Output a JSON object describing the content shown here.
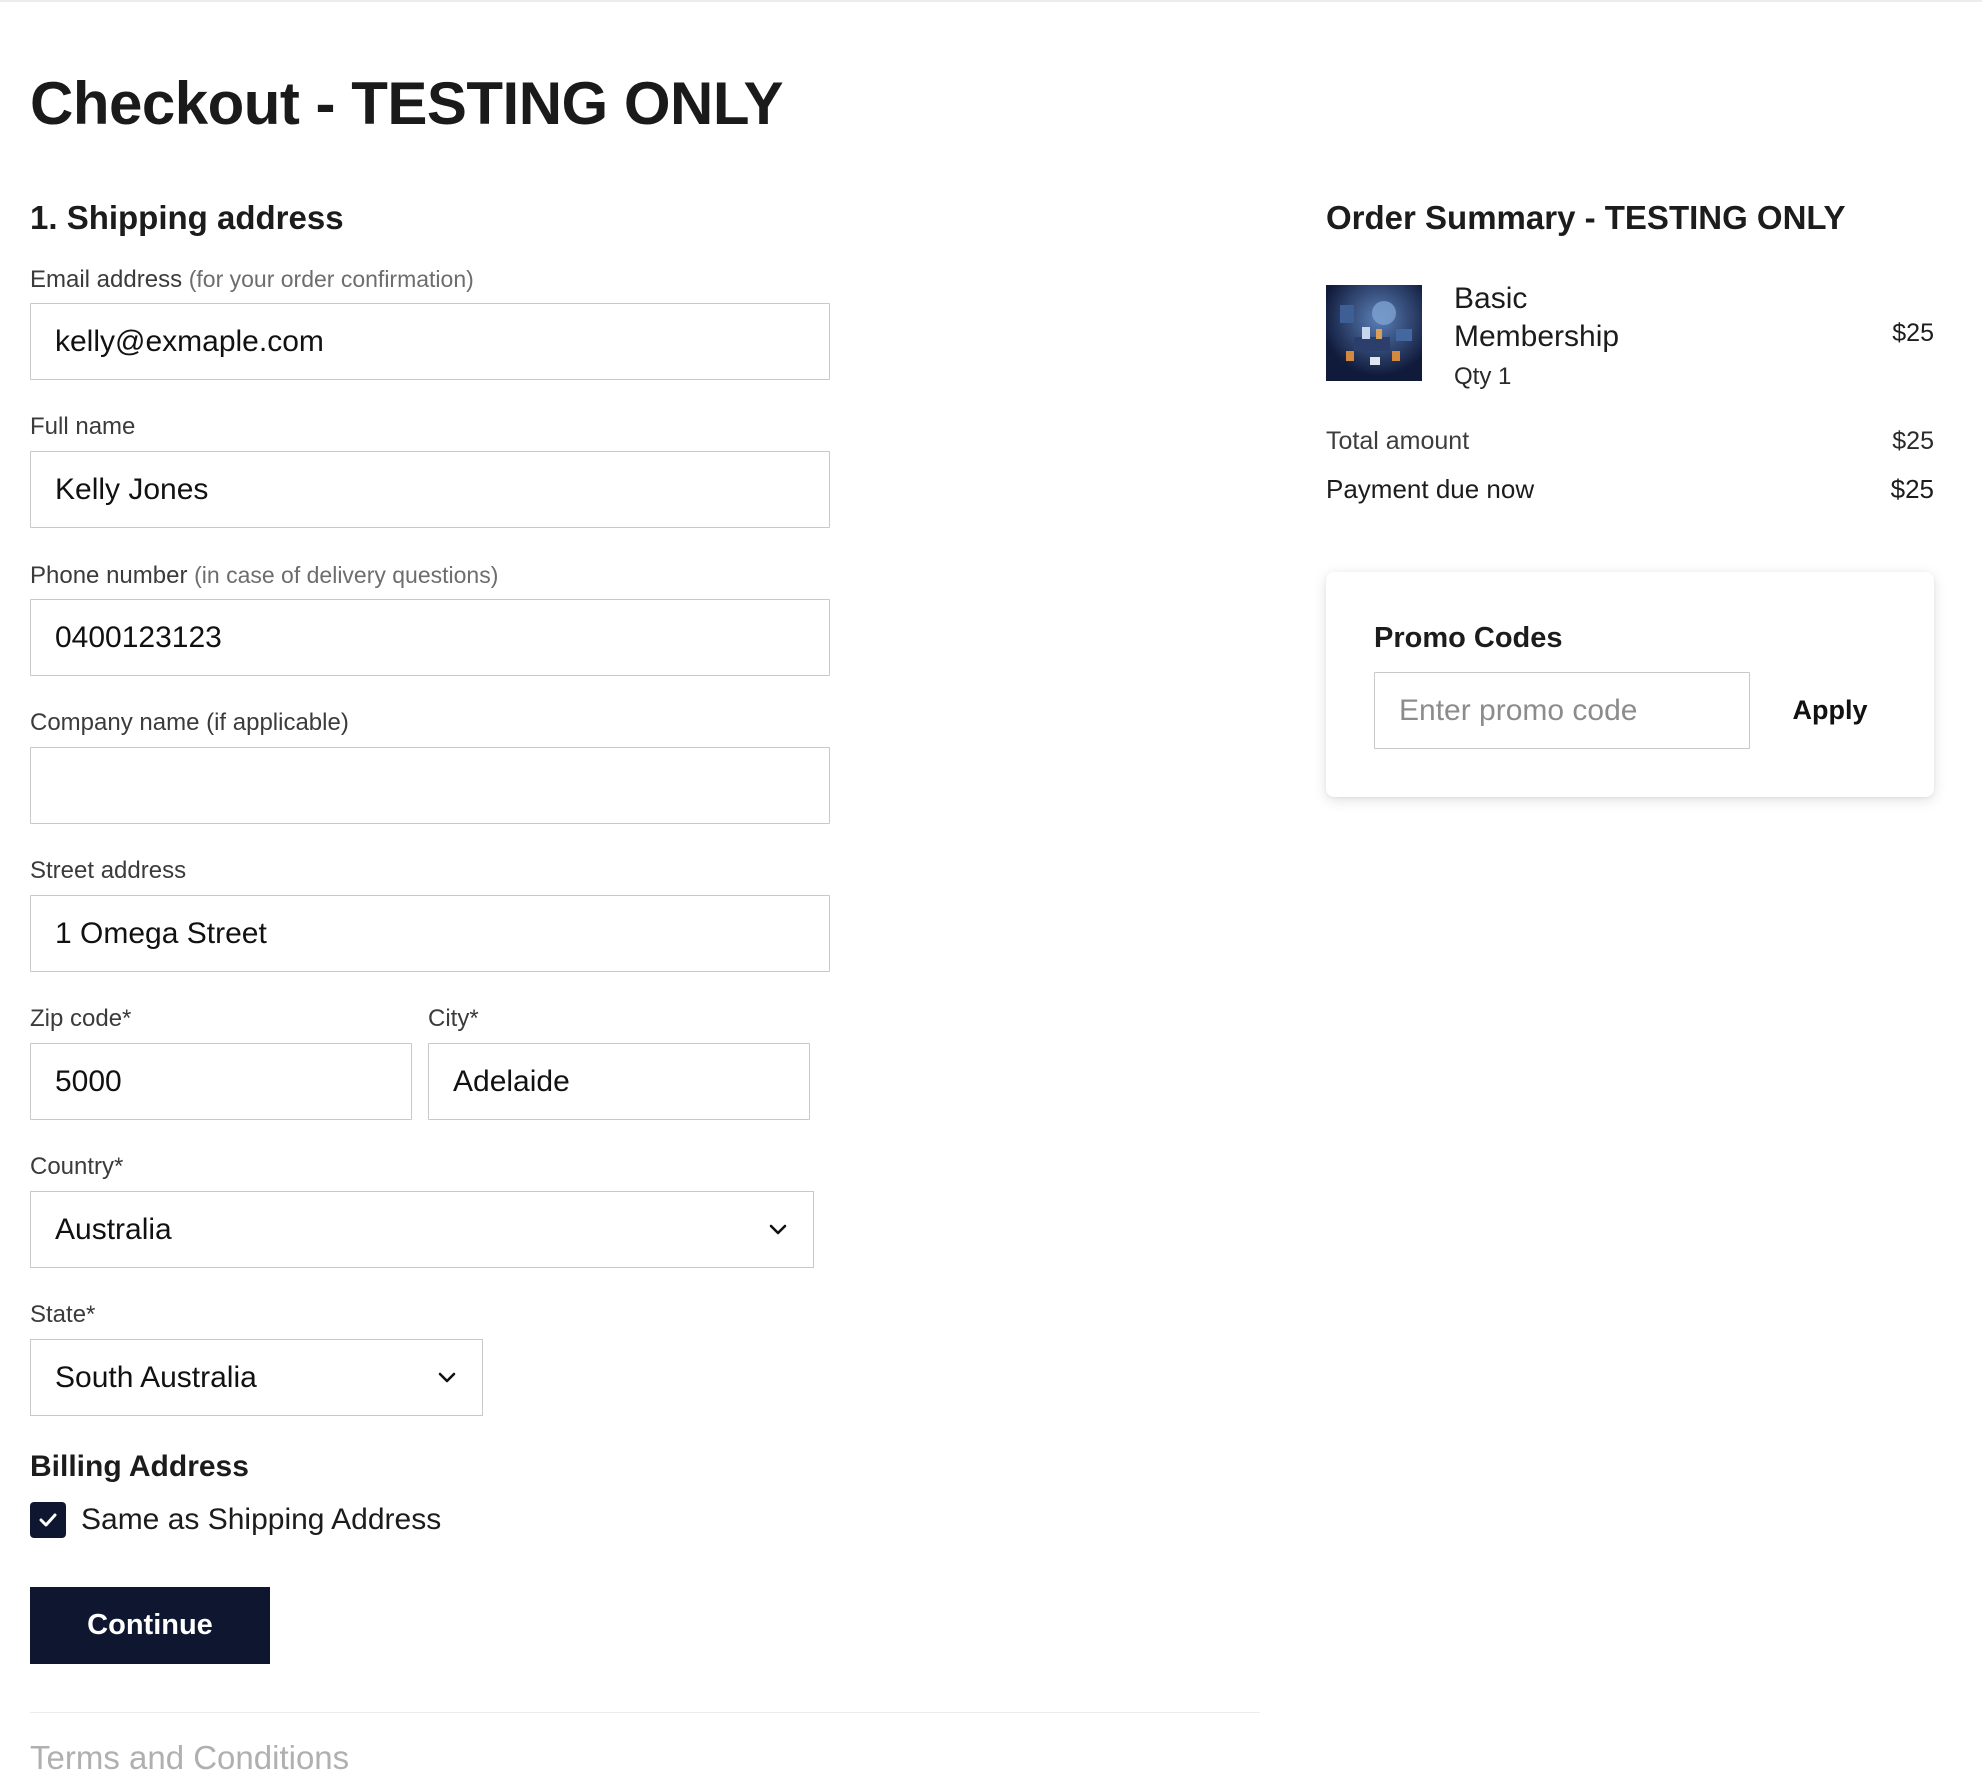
{
  "page": {
    "title": "Checkout - TESTING ONLY"
  },
  "shipping": {
    "section_title": "1. Shipping address",
    "email": {
      "label": "Email address",
      "hint": "(for your order confirmation)",
      "value": "kelly@exmaple.com"
    },
    "full_name": {
      "label": "Full name",
      "value": "Kelly Jones"
    },
    "phone": {
      "label": "Phone number",
      "hint": "(in case of delivery questions)",
      "value": "0400123123"
    },
    "company": {
      "label": "Company name (if applicable)",
      "value": ""
    },
    "street": {
      "label": "Street address",
      "value": "1 Omega Street"
    },
    "zip": {
      "label": "Zip code*",
      "value": "5000"
    },
    "city": {
      "label": "City*",
      "value": "Adelaide"
    },
    "country": {
      "label": "Country*",
      "selected": "Australia"
    },
    "state": {
      "label": "State*",
      "selected": "South Australia"
    }
  },
  "billing": {
    "title": "Billing Address",
    "same_as_shipping_label": "Same as Shipping Address",
    "same_as_shipping_checked": true
  },
  "actions": {
    "continue_label": "Continue"
  },
  "footer": {
    "terms_label": "Terms and Conditions"
  },
  "order_summary": {
    "title": "Order Summary - TESTING ONLY",
    "item": {
      "name": "Basic Membership",
      "qty_label": "Qty 1",
      "price": "$25",
      "thumbnail_icon": "product-thumbnail-image"
    },
    "total_label": "Total amount",
    "total_value": "$25",
    "due_label": "Payment due now",
    "due_value": "$25"
  },
  "promo": {
    "title": "Promo Codes",
    "placeholder": "Enter promo code",
    "apply_label": "Apply"
  },
  "colors": {
    "primary": "#0f1730",
    "border": "#c9c9c9",
    "muted_text": "#6d6d6d"
  }
}
